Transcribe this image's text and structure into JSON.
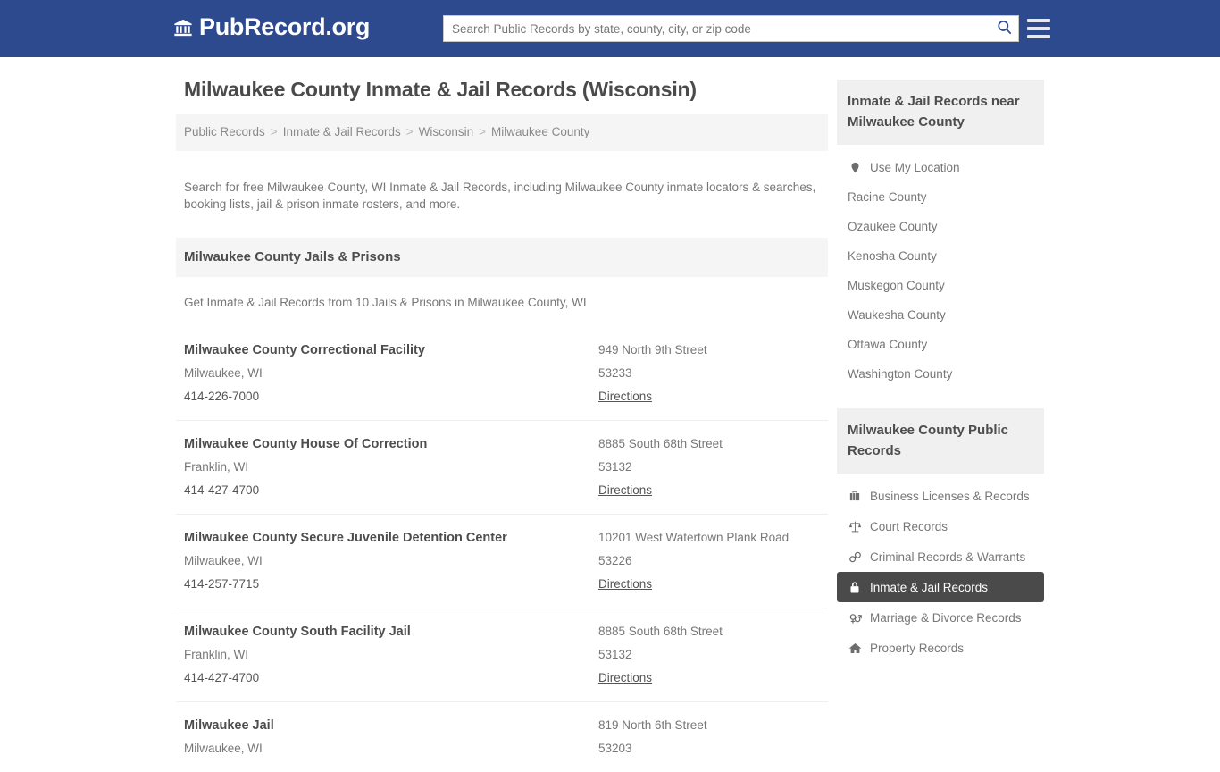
{
  "header": {
    "logo_text": "PubRecord.org",
    "logo_icon": "bank-building-icon",
    "search_placeholder": "Search Public Records by state, county, city, or zip code",
    "search_value": "",
    "search_icon": "search-icon",
    "menu_icon": "hamburger-menu-icon",
    "brand_color": "#2e4a8f"
  },
  "page": {
    "title": "Milwaukee County Inmate & Jail Records (Wisconsin)",
    "intro": "Search for free Milwaukee County, WI Inmate & Jail Records, including Milwaukee County inmate locators & searches, booking lists, jail & prison inmate rosters, and more."
  },
  "breadcrumb": {
    "separator": ">",
    "items": [
      {
        "label": "Public Records"
      },
      {
        "label": "Inmate & Jail Records"
      },
      {
        "label": "Wisconsin"
      },
      {
        "label": "Milwaukee County"
      }
    ]
  },
  "facilities_section": {
    "heading": "Milwaukee County Jails & Prisons",
    "subheading": "Get Inmate & Jail Records from 10 Jails & Prisons in Milwaukee County, WI",
    "directions_label": "Directions",
    "items": [
      {
        "name": "Milwaukee County Correctional Facility",
        "city_state": "Milwaukee, WI",
        "phone": "414-226-7000",
        "street": "949 North 9th Street",
        "zip": "53233"
      },
      {
        "name": "Milwaukee County House Of Correction",
        "city_state": "Franklin, WI",
        "phone": "414-427-4700",
        "street": "8885 South 68th Street",
        "zip": "53132"
      },
      {
        "name": "Milwaukee County Secure Juvenile Detention Center",
        "city_state": "Milwaukee, WI",
        "phone": "414-257-7715",
        "street": "10201 West Watertown Plank Road",
        "zip": "53226"
      },
      {
        "name": "Milwaukee County South Facility Jail",
        "city_state": "Franklin, WI",
        "phone": "414-427-4700",
        "street": "8885 South 68th Street",
        "zip": "53132"
      },
      {
        "name": "Milwaukee Jail",
        "city_state": "Milwaukee, WI",
        "phone": "",
        "street": "819 North 6th Street",
        "zip": "53203"
      }
    ]
  },
  "sidebar": {
    "nearby_panel": {
      "heading": "Inmate & Jail Records near Milwaukee County",
      "items": [
        {
          "label": "Use My Location",
          "icon": "map-pin-icon"
        },
        {
          "label": "Racine County",
          "icon": ""
        },
        {
          "label": "Ozaukee County",
          "icon": ""
        },
        {
          "label": "Kenosha County",
          "icon": ""
        },
        {
          "label": "Muskegon County",
          "icon": ""
        },
        {
          "label": "Waukesha County",
          "icon": ""
        },
        {
          "label": "Ottawa County",
          "icon": ""
        },
        {
          "label": "Washington County",
          "icon": ""
        }
      ]
    },
    "records_panel": {
      "heading": "Milwaukee County Public Records",
      "active_label": "Inmate & Jail Records",
      "active_color": "#4a4a4a",
      "items": [
        {
          "label": "Business Licenses & Records",
          "icon": "briefcase-icon",
          "active": false
        },
        {
          "label": "Court Records",
          "icon": "scales-icon",
          "active": false
        },
        {
          "label": "Criminal Records & Warrants",
          "icon": "handcuffs-icon",
          "active": false
        },
        {
          "label": "Inmate & Jail Records",
          "icon": "lock-icon",
          "active": true
        },
        {
          "label": "Marriage & Divorce Records",
          "icon": "gender-symbols-icon",
          "active": false
        },
        {
          "label": "Property Records",
          "icon": "house-icon",
          "active": false
        }
      ]
    }
  }
}
